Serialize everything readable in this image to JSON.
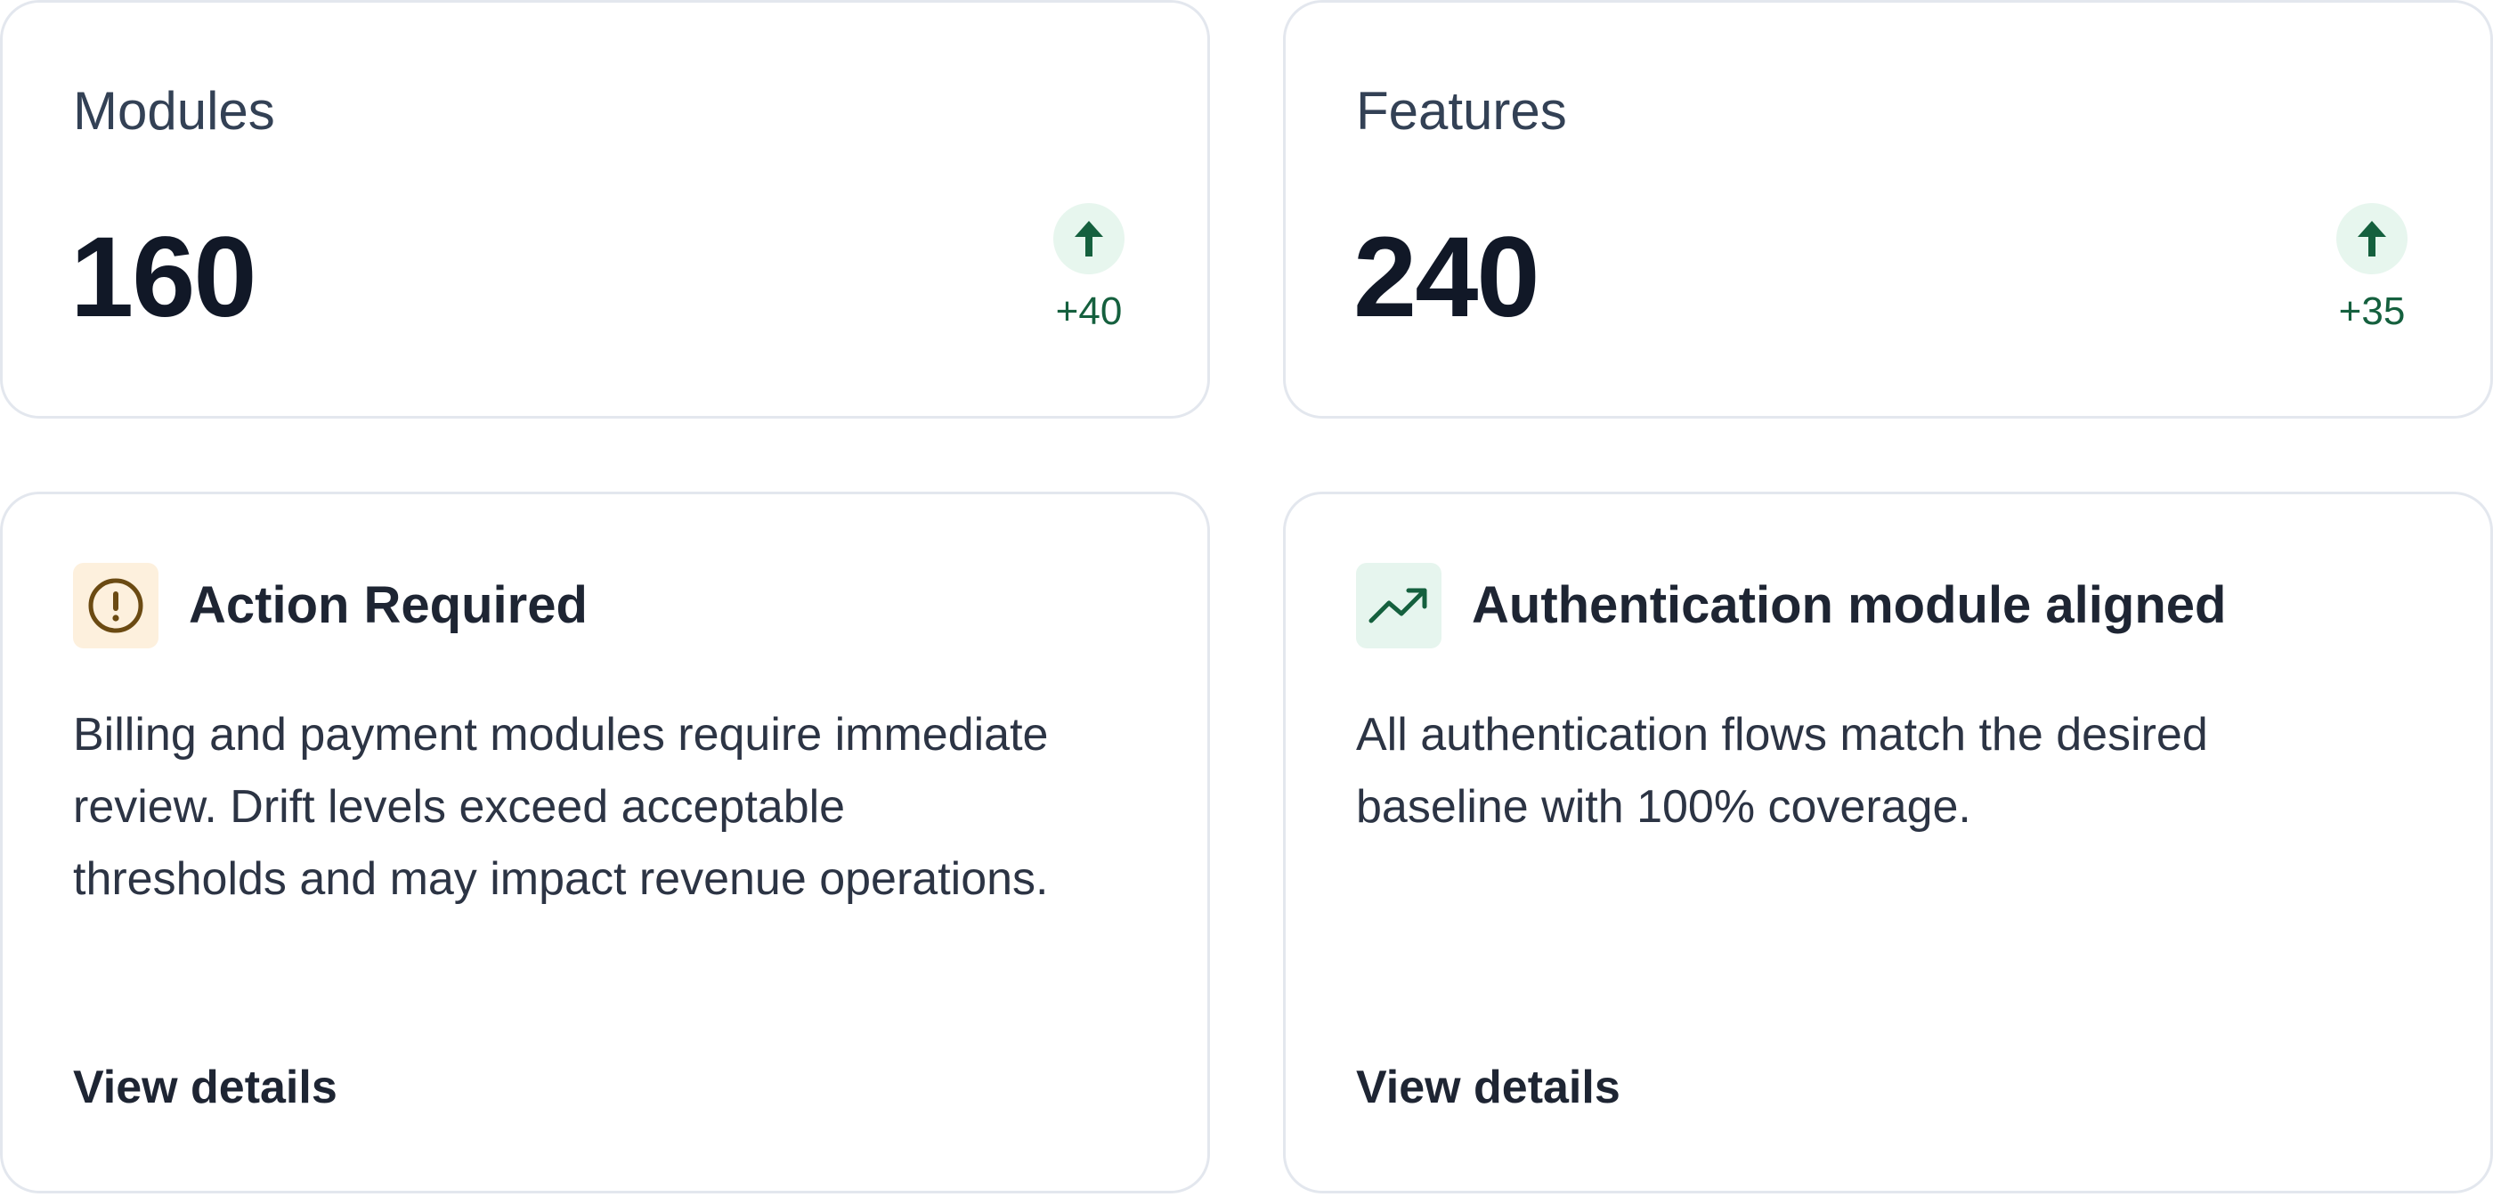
{
  "stats": [
    {
      "label": "Modules",
      "value": "160",
      "delta": "+40",
      "delta_icon": "arrow-up-icon"
    },
    {
      "label": "Features",
      "value": "240",
      "delta": "+35",
      "delta_icon": "arrow-up-icon"
    }
  ],
  "alerts": [
    {
      "icon": "alert-circle-icon",
      "title": "Action Required",
      "description": "Billing and payment modules require immediate review. Drift levels exceed acceptable thresholds and may impact revenue operations.",
      "link": "View details"
    },
    {
      "icon": "trending-up-icon",
      "title": "Authentication module aligned",
      "description": "All authentication flows match the desired baseline with 100% coverage.",
      "link": "View details"
    }
  ],
  "colors": {
    "positive": "#15603e",
    "positive_bg": "#e7f6ee",
    "warning": "#6b4a12",
    "warning_bg": "#fdf0dd",
    "border": "#e3e7ee",
    "text": "#1e2533"
  }
}
